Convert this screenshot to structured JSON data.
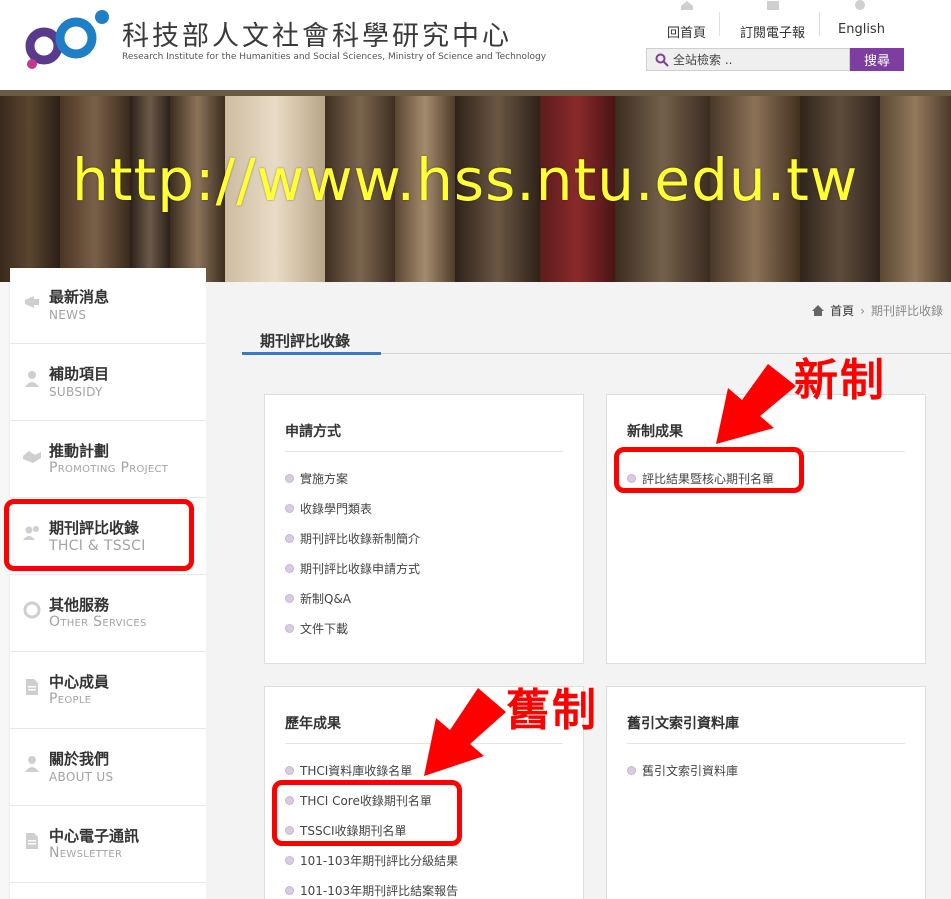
{
  "header": {
    "site_name_zh": "科技部人文社會科學研究中心",
    "site_name_en": "Research Institute for the Humanities and Social Sciences, Ministry of Science and Technology",
    "links": [
      {
        "label": "回首頁",
        "icon": "home-icon"
      },
      {
        "label": "訂閱電子報",
        "icon": "newsletter-icon"
      },
      {
        "label": "English",
        "icon": "globe-icon"
      }
    ],
    "search": {
      "placeholder": "全站檢索 ..",
      "button_label": "搜尋"
    },
    "accent_color": "#7d3ea0"
  },
  "banner": {
    "url_text": "http://www.hss.ntu.edu.tw",
    "text_color": "#ffff33"
  },
  "sidebar": {
    "items": [
      {
        "zh": "最新消息",
        "en": "NEWS",
        "icon": "megaphone-icon"
      },
      {
        "zh": "補助項目",
        "en": "SUBSIDY",
        "icon": "person-icon"
      },
      {
        "zh": "推動計劃",
        "en": "Promoting Project",
        "icon": "handshake-icon"
      },
      {
        "zh": "期刊評比收錄",
        "en": "THCI & TSSCI",
        "icon": "people-icon"
      },
      {
        "zh": "其他服務",
        "en": "Other Services",
        "icon": "ring-icon"
      },
      {
        "zh": "中心成員",
        "en": "People",
        "icon": "document-icon"
      },
      {
        "zh": "關於我們",
        "en": "ABOUT US",
        "icon": "person-icon"
      },
      {
        "zh": "中心電子通訊",
        "en": "Newsletter",
        "icon": "document-icon"
      }
    ]
  },
  "content": {
    "breadcrumb": {
      "home": "首頁",
      "current": "期刊評比收錄"
    },
    "page_title": "期刊評比收錄",
    "panels": {
      "apply": {
        "title": "申請方式",
        "items": [
          "實施方案",
          "收錄學門類表",
          "期刊評比收錄新制簡介",
          "期刊評比收錄申請方式",
          "新制Q&A",
          "文件下載"
        ]
      },
      "new_results": {
        "title": "新制成果",
        "items": [
          "評比結果暨核心期刊名單"
        ]
      },
      "past_results": {
        "title": "歷年成果",
        "items": [
          "THCI資料庫收錄名單",
          "THCI Core收錄期刊名單",
          "TSSCI收錄期刊名單",
          "101-103年期刊評比分級結果",
          "101-103年期刊評比結案報告"
        ]
      },
      "citation_db": {
        "title": "舊引文索引資料庫",
        "items": [
          "舊引文索引資料庫"
        ]
      }
    }
  },
  "annotations": {
    "new_label": "新制",
    "old_label": "舊制",
    "color": "#ff0000"
  }
}
